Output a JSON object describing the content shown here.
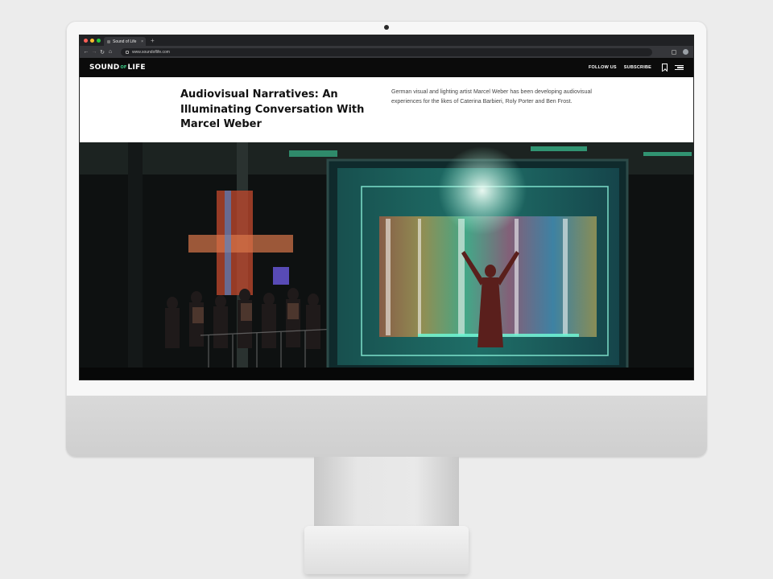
{
  "browser": {
    "tab_title": "Sound of Life",
    "tab_close": "×",
    "new_tab": "+",
    "url": "www.soundoflife.com",
    "back_icon": "←",
    "forward_icon": "→",
    "reload_icon": "↻",
    "home_icon": "⌂",
    "traffic_lights": [
      "#ff5f57",
      "#febc2e",
      "#28c840"
    ]
  },
  "site": {
    "logo_sound": "SOUND",
    "logo_of": "OF",
    "logo_life": "LIFE",
    "accent_color": "#3ed08a",
    "nav": {
      "follow_us": "FOLLOW US",
      "subscribe": "SUBSCRIBE"
    }
  },
  "article": {
    "headline": "Audiovisual Narratives: An Illuminating Conversation With Marcel Weber",
    "standfirst": "German visual and lighting artist Marcel Weber has been developing audiovisual experiences for the likes of Caterina Barbieri, Roly Porter and Ben Frost."
  }
}
